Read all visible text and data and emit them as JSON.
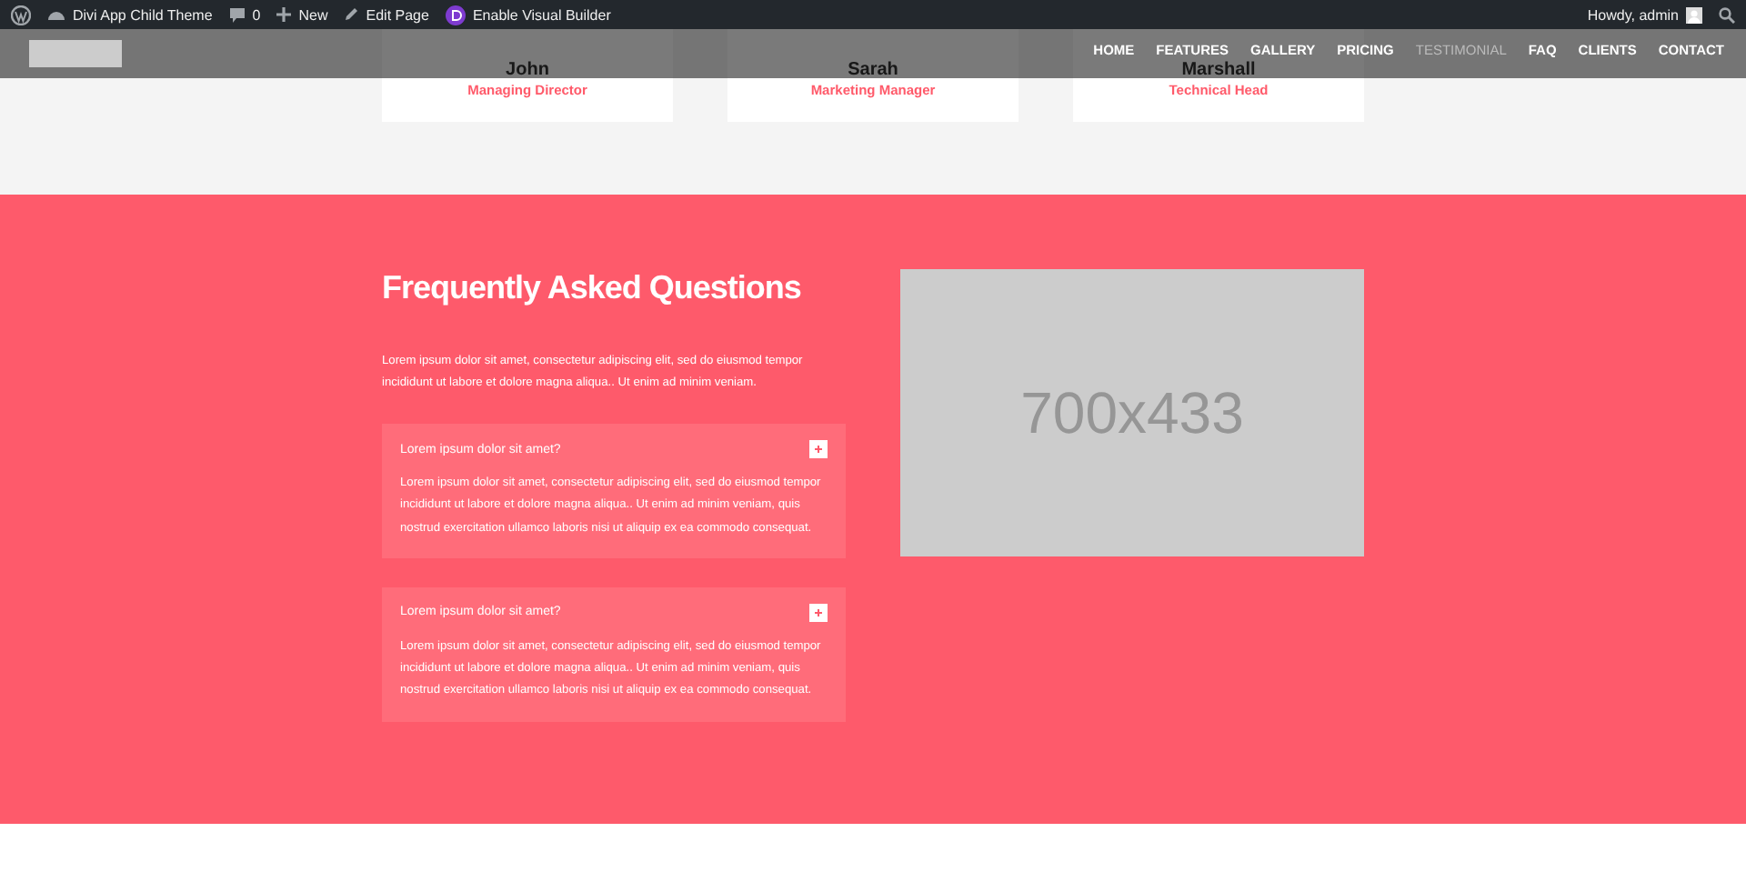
{
  "admin_bar": {
    "site": "Divi App Child Theme",
    "comments": "0",
    "new": "New",
    "edit": "Edit Page",
    "builder": "Enable Visual Builder",
    "greeting": "Howdy, admin"
  },
  "nav": [
    {
      "label": "HOME",
      "selected": false
    },
    {
      "label": "FEATURES",
      "selected": false
    },
    {
      "label": "GALLERY",
      "selected": false
    },
    {
      "label": "PRICING",
      "selected": false
    },
    {
      "label": "TESTIMONIAL",
      "selected": true
    },
    {
      "label": "FAQ",
      "selected": false
    },
    {
      "label": "CLIENTS",
      "selected": false
    },
    {
      "label": "CONTACT",
      "selected": false
    }
  ],
  "team": [
    {
      "name": "John",
      "role": "Managing Director"
    },
    {
      "name": "Sarah",
      "role": "Marketing Manager"
    },
    {
      "name": "Marshall",
      "role": "Technical Head"
    }
  ],
  "faq": {
    "title": "Frequently Asked Questions",
    "intro": "Lorem ipsum dolor sit amet, consectetur adipiscing elit, sed do eiusmod tempor incididunt ut labore et dolore magna aliqua.. Ut enim ad minim veniam.",
    "toggles": [
      {
        "question": "Lorem ipsum dolor sit amet?",
        "open": true,
        "answer": "Lorem ipsum dolor sit amet, consectetur adipiscing elit, sed do eiusmod tempor incididunt ut labore et dolore magna aliqua.. Ut enim ad minim veniam, quis nostrud exercitation ullamco laboris nisi ut aliquip ex ea commodo consequat."
      },
      {
        "question": "Lorem ipsum dolor sit amet?",
        "open": true,
        "answer": "Lorem ipsum dolor sit amet, consectetur adipiscing elit, sed do eiusmod tempor incididunt ut labore et dolore magna aliqua.. Ut enim ad minim veniam, quis nostrud exercitation ullamco laboris nisi ut aliquip ex ea commodo consequat."
      }
    ],
    "image_label": "700x433"
  }
}
